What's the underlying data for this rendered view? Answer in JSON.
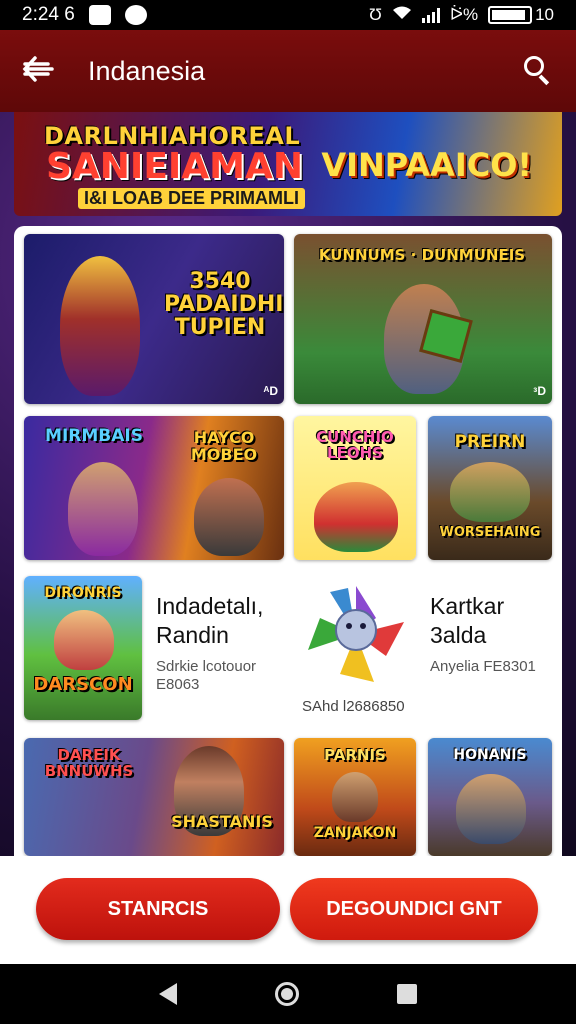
{
  "status_bar": {
    "time": "2:24 6",
    "right_text": "ᐖ%",
    "battery_text": "10"
  },
  "app_bar": {
    "title": "Indanesia"
  },
  "hero_banner": {
    "title_line1": "DARLNHIAHOREAL",
    "title_line2": "SANIEIAMAN",
    "subtitle": "I&I LOAB DEE PRIMAMLI",
    "right_text": "VINPAAICO!"
  },
  "tiles": [
    {
      "title": "3540 PADAIDHIN TUPIEN",
      "badge": "ᴬD"
    },
    {
      "title": "KUNNUMS · DUNMUNEIS",
      "badge": "ᶟD"
    },
    {
      "title": "MIRMBAIS",
      "subtitle": "HAYCO MOBEO"
    },
    {
      "title": "CUNCHIO LEOHS"
    },
    {
      "title": "PREIRN",
      "subtitle": "WORSEHAING"
    },
    {
      "title": "DIRONRIS",
      "subtitle": "DARSCON"
    },
    {
      "title": "DAREIK BNNUWHS",
      "subtitle": "SHASTANIS"
    },
    {
      "title": "PARNIS",
      "subtitle": "ZANJAKON"
    },
    {
      "title": "HONANIS"
    }
  ],
  "list_rows": [
    {
      "title_line1": "Indadetalı,",
      "title_line2": "Randin",
      "meta_line1": "Sdrkie lcotouor",
      "meta_line2": "E8063"
    },
    {
      "meta": "SAhd l2686850"
    },
    {
      "title_line1": "Kartkar",
      "title_line2": "3alda",
      "meta_line1": "Anyelia FE8301"
    }
  ],
  "buttons": {
    "primary": "STANRCIS",
    "secondary": "DEGOUNDICI GNT"
  },
  "colors": {
    "app_bar": "#6e0b0b",
    "button_red": "#d81b10",
    "panel_bg": "#ffffff"
  }
}
